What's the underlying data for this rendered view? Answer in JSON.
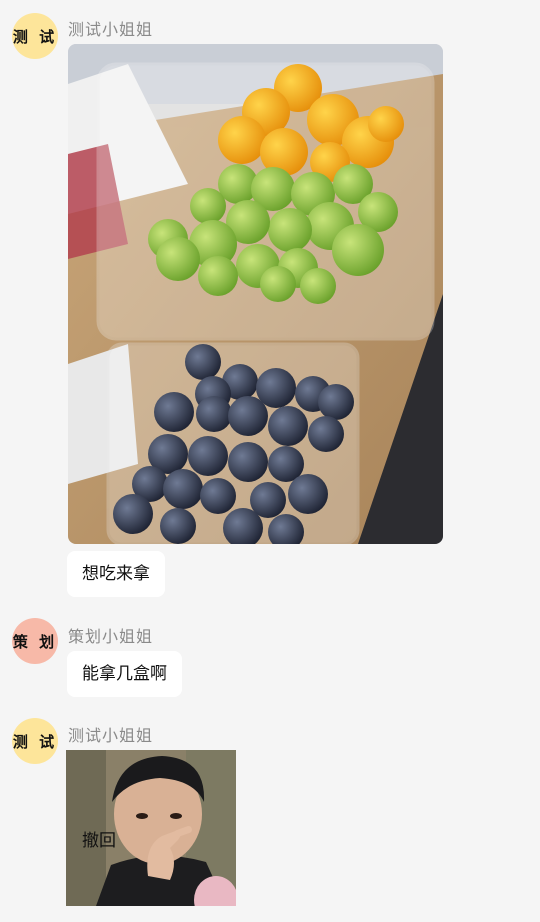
{
  "messages": [
    {
      "avatar_text": "测 试",
      "sender": "测试小姐姐",
      "avatar_color": "#fde59a"
    },
    {
      "text": "想吃来拿"
    },
    {
      "avatar_text": "策 划",
      "sender": "策划小姐姐",
      "text": "能拿几盒啊",
      "avatar_color": "#f7b9a8"
    },
    {
      "avatar_text": "测 试",
      "sender": "测试小姐姐",
      "sticker_text": "撤回",
      "avatar_color": "#fde59a"
    }
  ],
  "images": {
    "fruit_photo": "photo-fruits-kumquat-grapes-blueberries",
    "meme_sticker": "meme-boy-pointing"
  }
}
